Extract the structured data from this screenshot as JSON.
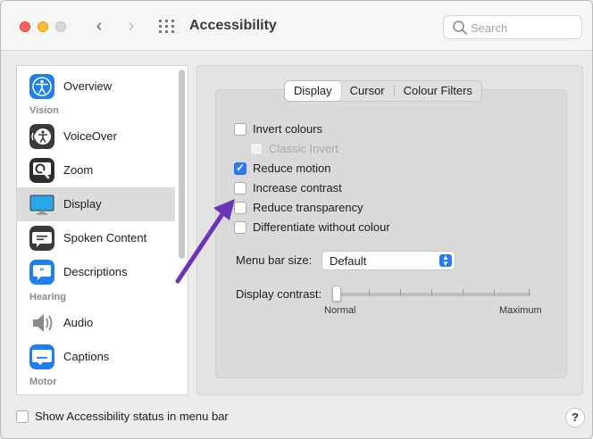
{
  "window": {
    "title": "Accessibility",
    "nav_back": "‹",
    "nav_forward": "›",
    "search_placeholder": "Search"
  },
  "sidebar": {
    "items": [
      {
        "label": "Overview",
        "icon": "accessibility-overview-icon",
        "color": "#1f7ff0"
      },
      {
        "section": "Vision"
      },
      {
        "label": "VoiceOver",
        "icon": "voiceover-icon",
        "color": "#3a3a3a"
      },
      {
        "label": "Zoom",
        "icon": "zoom-icon",
        "color": "#2d2d2d"
      },
      {
        "label": "Display",
        "icon": "display-icon",
        "color": "#29a8e8",
        "selected": true
      },
      {
        "label": "Spoken Content",
        "icon": "spoken-content-icon",
        "color": "#3a3a3a"
      },
      {
        "label": "Descriptions",
        "icon": "descriptions-icon",
        "color": "#1f7ff0"
      },
      {
        "section": "Hearing"
      },
      {
        "label": "Audio",
        "icon": "audio-speaker-icon",
        "color": "#8a8a8a"
      },
      {
        "label": "Captions",
        "icon": "captions-icon",
        "color": "#1f7ff0"
      },
      {
        "section": "Motor"
      }
    ]
  },
  "tabs": [
    {
      "label": "Display",
      "active": true
    },
    {
      "label": "Cursor",
      "active": false
    },
    {
      "label": "Colour Filters",
      "active": false
    }
  ],
  "options": [
    {
      "label": "Invert colours",
      "checked": false,
      "disabled": false
    },
    {
      "label": "Classic Invert",
      "checked": false,
      "disabled": true
    },
    {
      "label": "Reduce motion",
      "checked": true,
      "disabled": false
    },
    {
      "label": "Increase contrast",
      "checked": false,
      "disabled": false
    },
    {
      "label": "Reduce transparency",
      "checked": false,
      "disabled": false
    },
    {
      "label": "Differentiate without colour",
      "checked": false,
      "disabled": false
    }
  ],
  "menu_bar_size": {
    "label": "Menu bar size:",
    "value": "Default"
  },
  "display_contrast": {
    "label": "Display contrast:",
    "min_label": "Normal",
    "max_label": "Maximum",
    "value": 0
  },
  "footer": {
    "status_label": "Show Accessibility status in menu bar",
    "status_checked": false,
    "help": "?"
  },
  "colors": {
    "accent": "#2a7bf6",
    "annotation_arrow": "#6b35b8"
  }
}
